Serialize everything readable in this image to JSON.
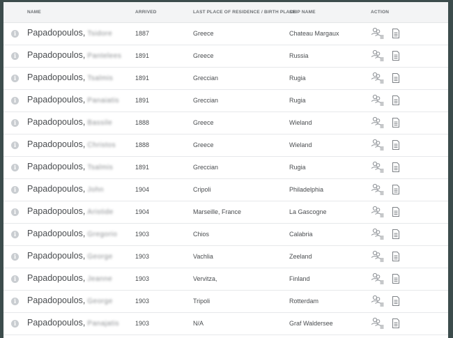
{
  "table": {
    "headers": {
      "name": "NAME",
      "arrived": "ARRIVED",
      "residence": "LAST PLACE OF RESIDENCE / BIRTH PLACE",
      "ship": "SHIP NAME",
      "action": "ACTION"
    },
    "info_glyph": "i",
    "rows": [
      {
        "surname": "Papadopoulos,",
        "first": "Tsidore",
        "arrived": "1887",
        "residence": "Greece",
        "ship": "Chateau Margaux"
      },
      {
        "surname": "Papadopoulos,",
        "first": "Pantelees",
        "arrived": "1891",
        "residence": "Greece",
        "ship": "Russia"
      },
      {
        "surname": "Papadopoulos,",
        "first": "Tsalmis",
        "arrived": "1891",
        "residence": "Greccian",
        "ship": "Rugia"
      },
      {
        "surname": "Papadopoulos,",
        "first": "Panaiatis",
        "arrived": "1891",
        "residence": "Greccian",
        "ship": "Rugia"
      },
      {
        "surname": "Papadopoulos,",
        "first": "Bassile",
        "arrived": "1888",
        "residence": "Greece",
        "ship": "Wieland"
      },
      {
        "surname": "Papadopoulos,",
        "first": "Christos",
        "arrived": "1888",
        "residence": "Greece",
        "ship": "Wieland"
      },
      {
        "surname": "Papadopoulos,",
        "first": "Tsalmis",
        "arrived": "1891",
        "residence": "Greccian",
        "ship": "Rugia"
      },
      {
        "surname": "Papadopoulos,",
        "first": "John",
        "arrived": "1904",
        "residence": "Cripoli",
        "ship": "Philadelphia"
      },
      {
        "surname": "Papadopoulos,",
        "first": "Aristide",
        "arrived": "1904",
        "residence": "Marseille, France",
        "ship": "La Gascogne"
      },
      {
        "surname": "Papadopoulos,",
        "first": "Gregorio",
        "arrived": "1903",
        "residence": "Chios",
        "ship": "Calabria"
      },
      {
        "surname": "Papadopoulos,",
        "first": "George",
        "arrived": "1903",
        "residence": "Vachlia",
        "ship": "Zeeland"
      },
      {
        "surname": "Papadopoulos,",
        "first": "Jeanne",
        "arrived": "1903",
        "residence": "Vervitza,",
        "ship": "Finland"
      },
      {
        "surname": "Papadopoulos,",
        "first": "George",
        "arrived": "1903",
        "residence": "Tripoli",
        "ship": "Rotterdam"
      },
      {
        "surname": "Papadopoulos,",
        "first": "Panajatis",
        "arrived": "1903",
        "residence": "N/A",
        "ship": "Graf Waldersee"
      }
    ]
  },
  "icons": {
    "info": "info-icon",
    "passengers": "passenger-group-icon",
    "document": "document-icon"
  },
  "colors": {
    "background": "#3c4c4c",
    "header_bg": "#f3f4f5",
    "text": "#4a4d50",
    "icon_gray": "#8c9095"
  }
}
